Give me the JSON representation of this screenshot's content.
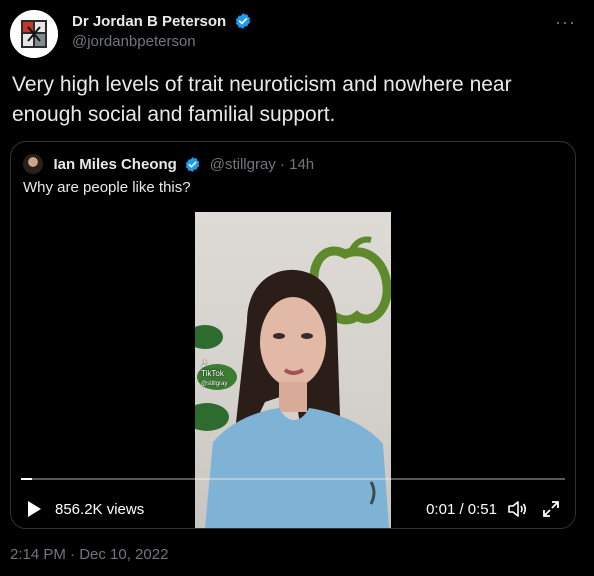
{
  "tweet": {
    "author": {
      "display_name": "Dr Jordan B Peterson",
      "handle": "@jordanbpeterson",
      "verified": true
    },
    "more_icon": "more-horizontal-icon",
    "text": "Very high levels of trait neuroticism and nowhere near enough social and familial support.",
    "timestamp": "2:14 PM · Dec 10, 2022"
  },
  "quote": {
    "author": {
      "display_name": "Ian Miles Cheong",
      "handle_time": "@stillgray · 14h",
      "verified": true
    },
    "text": "Why are people like this?",
    "video": {
      "watermark": "TikTok",
      "watermark_user": "@stillgray",
      "views": "856.2K views",
      "time": "0:01 / 0:51",
      "progress": 0.02,
      "icons": {
        "play": "play-icon",
        "volume": "volume-icon",
        "fullscreen": "fullscreen-icon"
      }
    }
  },
  "colors": {
    "background": "#000000",
    "text": "#e7e9ea",
    "secondary": "#71767b",
    "border": "#2f3336",
    "verified": "#1d9bf0"
  }
}
